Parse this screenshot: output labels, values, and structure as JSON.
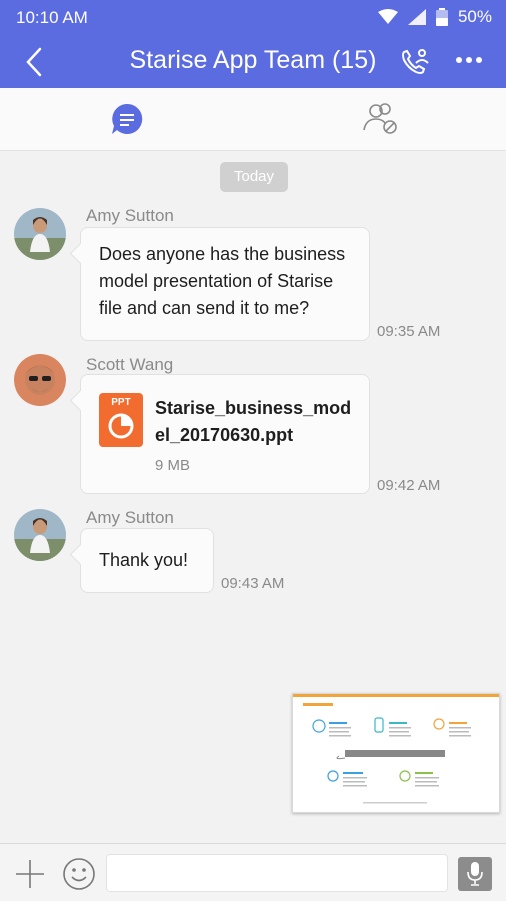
{
  "status": {
    "time": "10:10 AM",
    "battery": "50%"
  },
  "header": {
    "title": "Starise App Team (15)"
  },
  "tabs": {
    "chat_icon": "chat-bubble-icon",
    "members_icon": "members-settings-icon"
  },
  "date_chip": "Today",
  "messages": [
    {
      "sender": "Amy Sutton",
      "text": "Does anyone has the business model presentation of Starise file and can send it to me?",
      "time": "09:35 AM"
    },
    {
      "sender": "Scott Wang",
      "file": {
        "ext": "PPT",
        "name": "Starise_business_model_20170630.ppt",
        "size": "9 MB"
      },
      "time": "09:42 AM"
    },
    {
      "sender": "Amy Sutton",
      "text": "Thank you!",
      "time": "09:43 AM"
    }
  ],
  "input": {
    "placeholder": ""
  },
  "colors": {
    "accent": "#5b6be0",
    "file_orange": "#f26b2f"
  }
}
